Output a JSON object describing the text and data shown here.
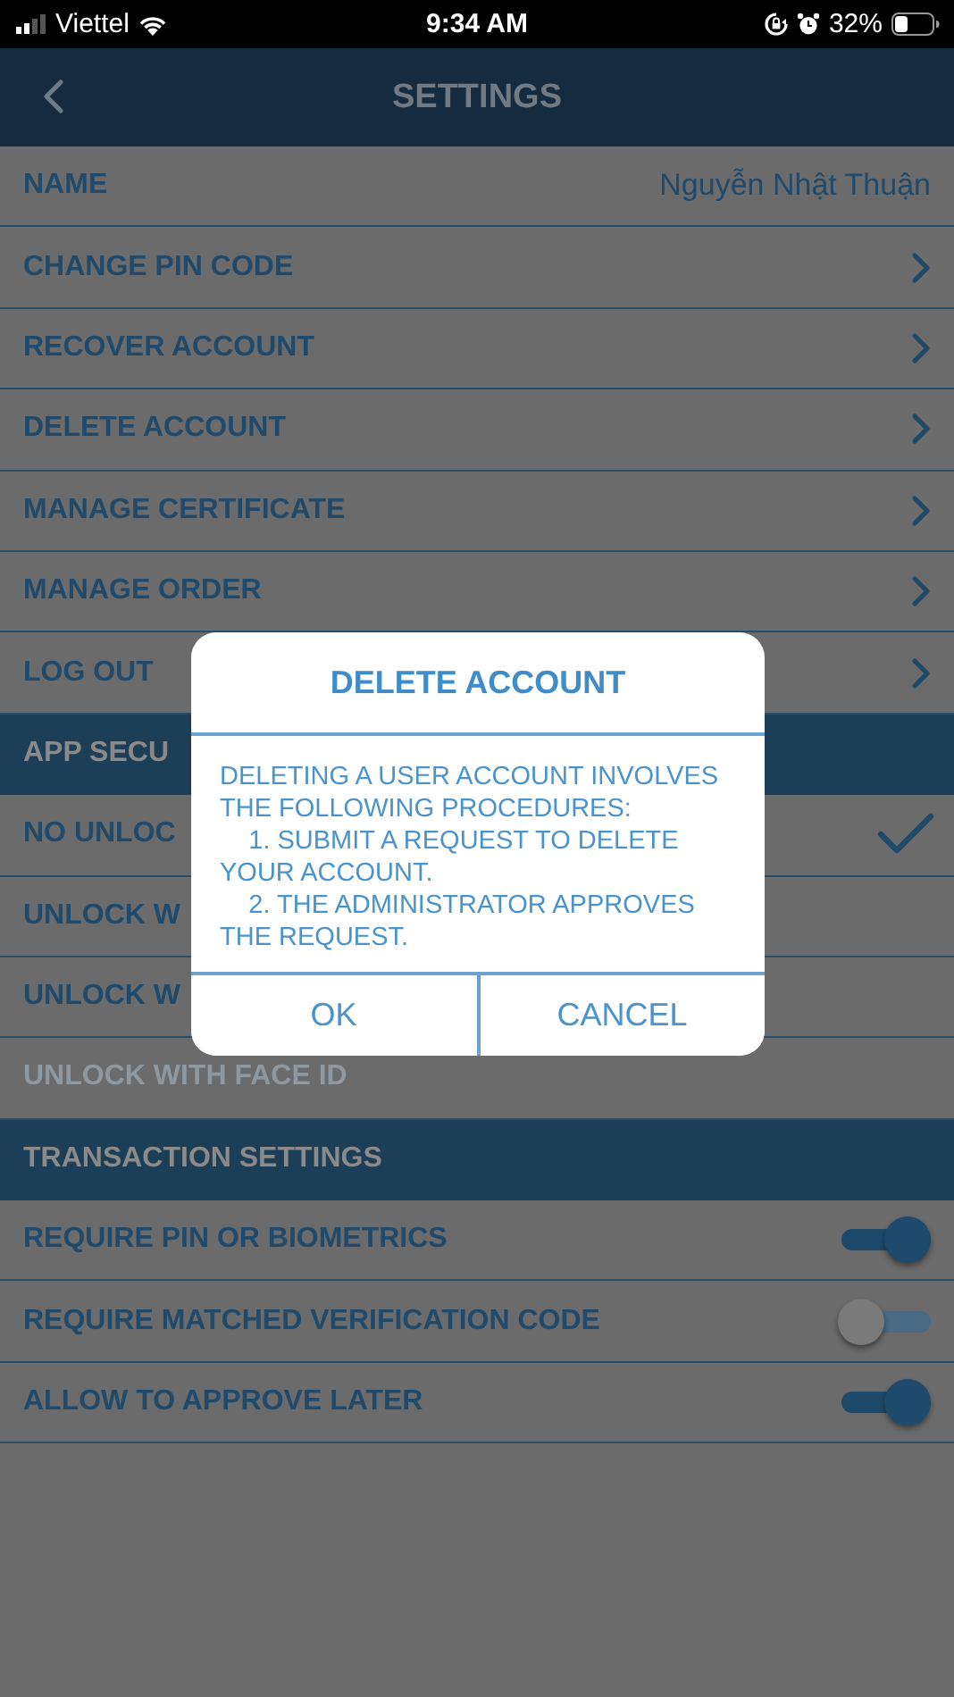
{
  "status_bar": {
    "carrier": "Viettel",
    "time": "9:34 AM",
    "battery": "32%"
  },
  "header": {
    "title": "SETTINGS"
  },
  "rows": [
    {
      "kind": "value",
      "label": "NAME",
      "value": "Nguyễn Nhật Thuận"
    },
    {
      "kind": "link",
      "label": "CHANGE PIN CODE"
    },
    {
      "kind": "link",
      "label": "RECOVER ACCOUNT"
    },
    {
      "kind": "link",
      "label": "DELETE ACCOUNT"
    },
    {
      "kind": "link",
      "label": "MANAGE CERTIFICATE"
    },
    {
      "kind": "link",
      "label": "MANAGE ORDER"
    },
    {
      "kind": "link",
      "label": "LOG OUT"
    },
    {
      "kind": "section",
      "label": "APP SECU"
    },
    {
      "kind": "choice",
      "label": "NO UNLOC",
      "selected": true,
      "disabled": false
    },
    {
      "kind": "choice",
      "label": "UNLOCK W",
      "selected": false,
      "disabled": false
    },
    {
      "kind": "choice",
      "label": "UNLOCK W",
      "selected": false,
      "disabled": false
    },
    {
      "kind": "choice",
      "label": "UNLOCK WITH FACE ID",
      "selected": false,
      "disabled": true
    },
    {
      "kind": "section",
      "label": "TRANSACTION SETTINGS"
    },
    {
      "kind": "toggle",
      "label": "REQUIRE PIN OR BIOMETRICS",
      "on": true
    },
    {
      "kind": "toggle",
      "label": "REQUIRE MATCHED VERIFICATION CODE",
      "on": false
    },
    {
      "kind": "toggle",
      "label": "ALLOW TO APPROVE LATER",
      "on": true
    }
  ],
  "dialog": {
    "title": "DELETE ACCOUNT",
    "message": "DELETING A USER ACCOUNT INVOLVES THE FOLLOWING PROCEDURES:\n    1. SUBMIT A REQUEST TO DELETE YOUR ACCOUNT.\n    2. THE ADMINISTRATOR APPROVES THE REQUEST.",
    "buttons": [
      "OK",
      "CANCEL"
    ]
  }
}
